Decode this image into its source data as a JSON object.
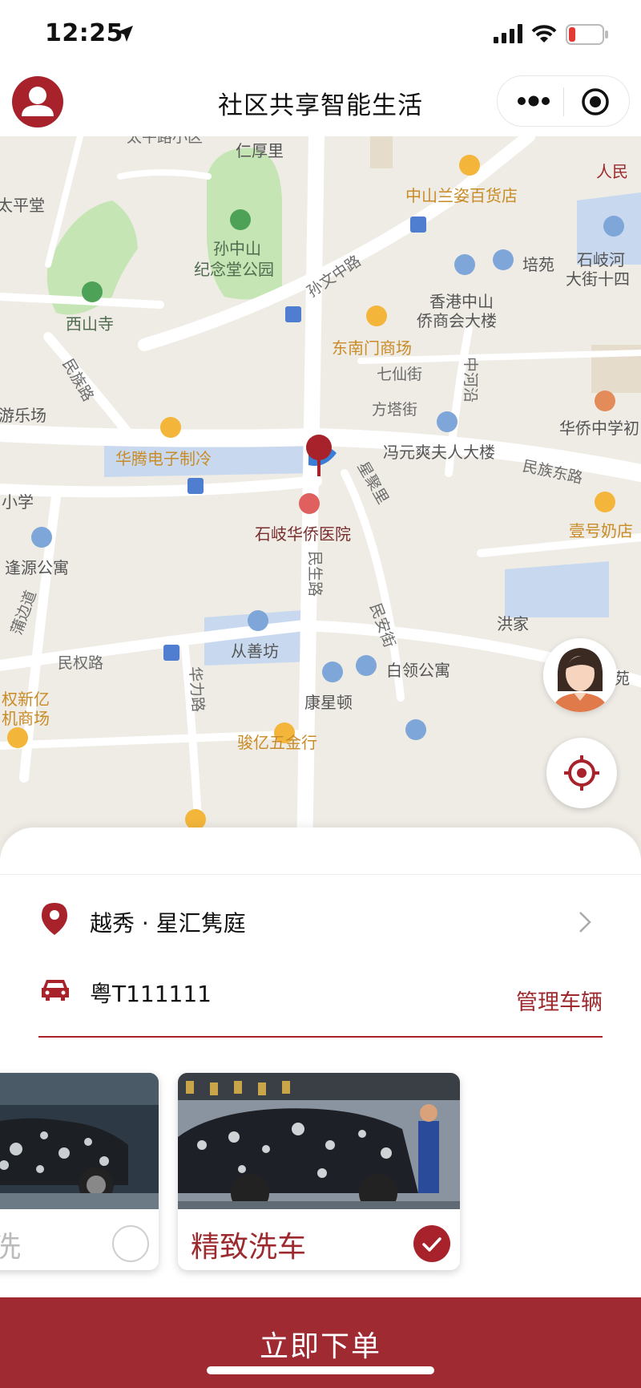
{
  "status_bar": {
    "time": "12:25"
  },
  "nav": {
    "title": "社区共享智能生活"
  },
  "map": {
    "labels": {
      "taiping_xiaoqu": "太平路小区",
      "renhouli": "仁厚里",
      "renminlu": "人民",
      "taipingtang": "太平堂",
      "zhongshan_lanzi": "中山兰姿百货店",
      "park_line1": "孙中山",
      "park_line2": "纪念堂公园",
      "sunwen_road": "孙文中路",
      "peiyuan": "培苑",
      "shiqi_line1": "石岐河",
      "shiqi_line2": "大街十四",
      "hk_line1": "香港中山",
      "hk_line2": "侨商会大楼",
      "xishan": "西山寺",
      "dongnanmen": "东南门商场",
      "minzu_road": "民族路",
      "qixian": "七仙街",
      "zhonghe": "中河沿",
      "fangta": "方塔街",
      "youlechang": "游乐场",
      "huaqiao_middle": "华侨中学初",
      "huateng": "华腾电子制冷",
      "feng_building": "冯元爽夫人大楼",
      "minzu_east": "民族东路",
      "xingju": "星聚里",
      "xiaoxue": "小学",
      "hospital": "石岐华侨医院",
      "yihao": "壹号奶店",
      "fengyuan": "逢源公寓",
      "minsheng": "民生路",
      "pujiaodao": "蒲边道",
      "minan": "民安街",
      "hongjia": "洪家",
      "congshanfang": "从善坊",
      "minquan": "民权路",
      "huali": "华力路",
      "bailing": "白领公寓",
      "haoyuan": "豪苑",
      "kangxing": "康星顿",
      "xinyi_line1": "权新亿",
      "xinyi_line2": "机商场",
      "junyi": "骏亿五金行"
    }
  },
  "sheet": {
    "location": "越秀 · 星汇隽庭",
    "plate": "粤T111111",
    "manage_vehicles": "管理车辆",
    "services": [
      {
        "label": "洗",
        "selected": false
      },
      {
        "label": "精致洗车",
        "selected": true
      }
    ],
    "order_button": "立即下单"
  },
  "icons": {
    "pin": "location-pin-icon",
    "car": "car-icon",
    "chevron": "chevron-right-icon",
    "locate": "locate-icon",
    "more": "more-dots-icon",
    "close_target": "target-icon"
  },
  "colors": {
    "brand": "#a8222c",
    "brand_text": "#9c2a2f"
  }
}
